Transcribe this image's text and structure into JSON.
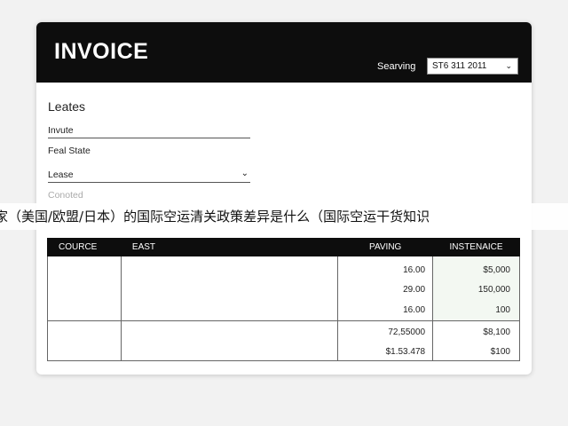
{
  "header": {
    "title": "INVOICE",
    "saving_label": "Searving",
    "date_value": "ST6 311 2011"
  },
  "form": {
    "section_title": "Leates",
    "field_1": "Invute",
    "field_2": "Feal State",
    "select_value": "Lease",
    "placeholder": "Conoted"
  },
  "banner": {
    "text": "家（美国/欧盟/日本）的国际空运清关政策差异是什么（国际空运干货知识"
  },
  "table": {
    "headers": [
      "COURCE",
      "EAST",
      "PAVING",
      "INSTENAICE"
    ],
    "rows": [
      [
        "",
        "",
        "16.00",
        "$5,000"
      ],
      [
        "",
        "",
        "29.00",
        "150,000"
      ],
      [
        "",
        "",
        "16.00",
        "100"
      ]
    ],
    "totals": [
      [
        "",
        "",
        "72,55000",
        "$8,100"
      ],
      [
        "",
        "",
        "$1.53.478",
        "$100"
      ]
    ]
  },
  "colors": {
    "header_bg": "#0d0d0d",
    "page_bg": "#f2f2f2",
    "highlight_column": "#f3f8f2"
  },
  "icons": {
    "date_dropdown": "chevron-down-icon",
    "lease_dropdown": "chevron-down-icon"
  }
}
